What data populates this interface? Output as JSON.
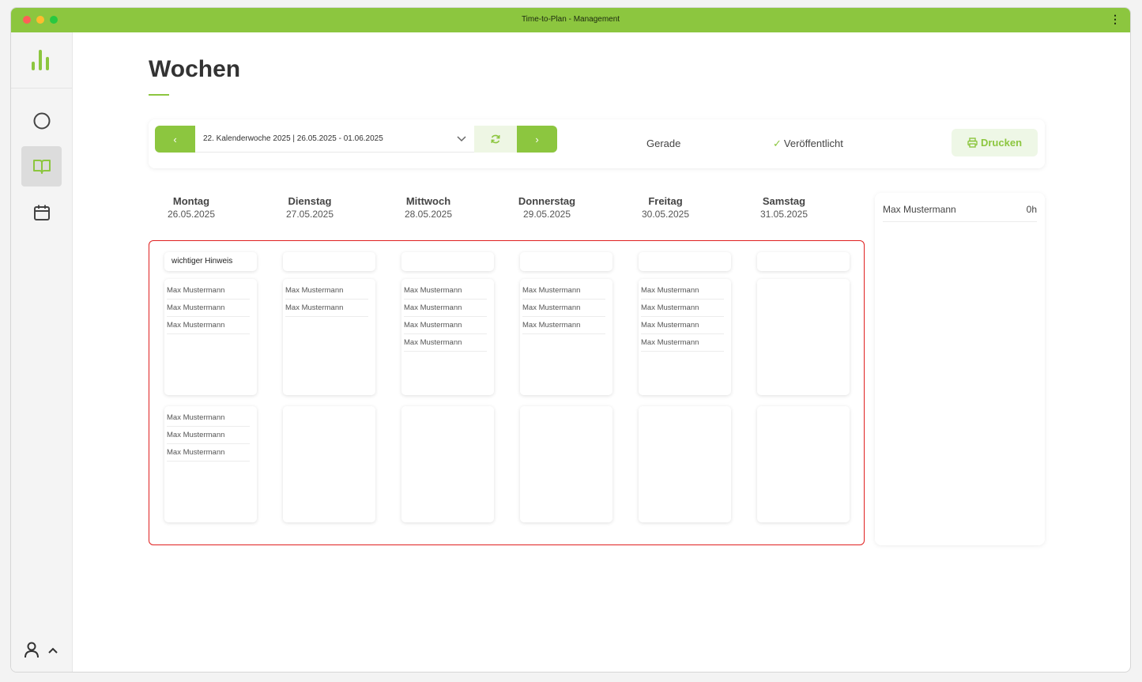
{
  "window": {
    "title": "Time-to-Plan - Management"
  },
  "sidebar": {
    "nav": [
      {
        "icon": "circle-icon",
        "active": false
      },
      {
        "icon": "book-icon",
        "active": true
      },
      {
        "icon": "calendar-icon",
        "active": false
      }
    ],
    "user_icon": "user-icon",
    "expand_icon": "chevron-up-icon"
  },
  "page": {
    "title": "Wochen"
  },
  "toolbar": {
    "prev_label": "‹",
    "next_label": "›",
    "week_selected": "22. Kalenderwoche 2025 | 26.05.2025 - 01.06.2025",
    "parity": "Gerade",
    "published_check": "✓",
    "published_label": "Veröffentlicht",
    "print_label": "Drucken"
  },
  "days": [
    {
      "name": "Montag",
      "date": "26.05.2025",
      "note": "wichtiger Hinweis",
      "slot1": [
        "Max Mustermann",
        "Max Mustermann",
        "Max Mustermann"
      ],
      "slot2": [
        "Max Mustermann",
        "Max Mustermann",
        "Max Mustermann"
      ]
    },
    {
      "name": "Dienstag",
      "date": "27.05.2025",
      "note": "",
      "slot1": [
        "Max Mustermann",
        "Max Mustermann"
      ],
      "slot2": []
    },
    {
      "name": "Mittwoch",
      "date": "28.05.2025",
      "note": "",
      "slot1": [
        "Max Mustermann",
        "Max Mustermann",
        "Max Mustermann",
        "Max Mustermann"
      ],
      "slot2": []
    },
    {
      "name": "Donnerstag",
      "date": "29.05.2025",
      "note": "",
      "slot1": [
        "Max Mustermann",
        "Max Mustermann",
        "Max Mustermann"
      ],
      "slot2": []
    },
    {
      "name": "Freitag",
      "date": "30.05.2025",
      "note": "",
      "slot1": [
        "Max Mustermann",
        "Max Mustermann",
        "Max Mustermann",
        "Max Mustermann"
      ],
      "slot2": []
    },
    {
      "name": "Samstag",
      "date": "31.05.2025",
      "note": "",
      "slot1": [],
      "slot2": []
    }
  ],
  "employees": [
    {
      "name": "Max Mustermann",
      "hours": "0h"
    }
  ],
  "colors": {
    "accent": "#8cc63f",
    "highlight": "#e02020"
  }
}
